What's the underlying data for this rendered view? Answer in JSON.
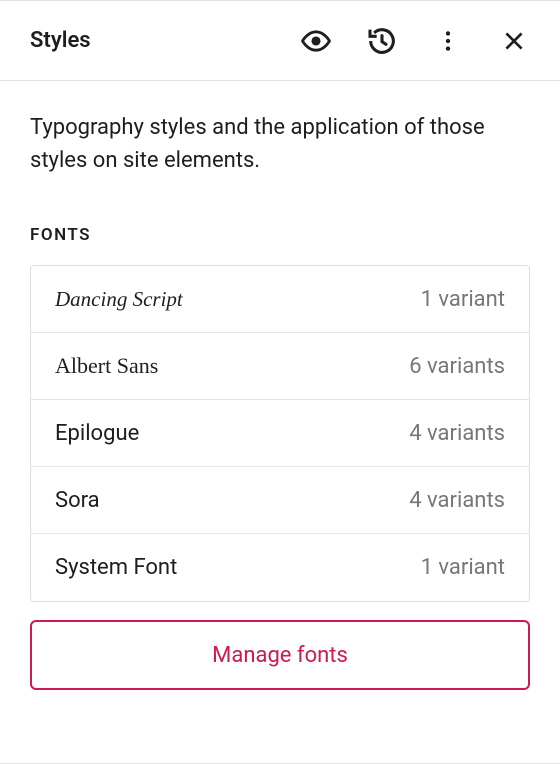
{
  "header": {
    "title": "Styles"
  },
  "description": "Typography styles and the application of those styles on site elements.",
  "section_label": "Fonts",
  "fonts": [
    {
      "name": "Dancing Script",
      "variants": "1 variant",
      "style": "script"
    },
    {
      "name": "Albert Sans",
      "variants": "6 variants",
      "style": "serif"
    },
    {
      "name": "Epilogue",
      "variants": "4 variants",
      "style": "sans"
    },
    {
      "name": "Sora",
      "variants": "4 variants",
      "style": "sans"
    },
    {
      "name": "System Font",
      "variants": "1 variant",
      "style": "sans"
    }
  ],
  "manage_button": "Manage fonts"
}
